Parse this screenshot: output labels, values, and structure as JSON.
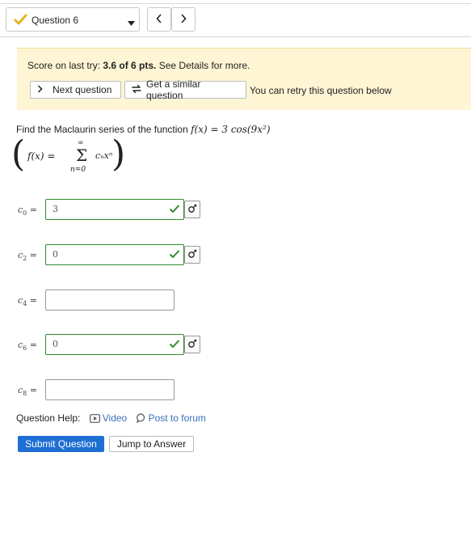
{
  "header": {
    "question_label": "Question 6",
    "prev_symbol": "‹",
    "next_symbol": "›"
  },
  "score": {
    "prefix": "Score on last try: ",
    "value": "3.6 of 6 pts.",
    "suffix": " See Details for more."
  },
  "actions": {
    "next_question": "Next question",
    "similar_question": "Get a similar question",
    "retry_note": "You can retry this question below"
  },
  "problem": {
    "prompt": "Find the Maclaurin series of the function ",
    "function": "f(x) = 3 cos(9x²)",
    "series_lhs": "f(x) =",
    "sum_upper": "∞",
    "sum_lower": "n=0",
    "sum_term": "cₙxⁿ"
  },
  "answers": [
    {
      "label": "c",
      "sub": "0",
      "value": "3",
      "status": "correct"
    },
    {
      "label": "c",
      "sub": "2",
      "value": "0",
      "status": "correct"
    },
    {
      "label": "c",
      "sub": "4",
      "value": "",
      "status": "empty"
    },
    {
      "label": "c",
      "sub": "6",
      "value": "0",
      "status": "correct"
    },
    {
      "label": "c",
      "sub": "8",
      "value": "",
      "status": "empty"
    }
  ],
  "help": {
    "label": "Question Help:",
    "video": "Video",
    "forum": "Post to forum"
  },
  "buttons": {
    "submit": "Submit Question",
    "jump": "Jump to Answer"
  },
  "colors": {
    "accent": "#1f6ed4",
    "correct": "#2e8b2e",
    "score_bg": "#fdf5d4",
    "link": "#3b6fb5"
  }
}
